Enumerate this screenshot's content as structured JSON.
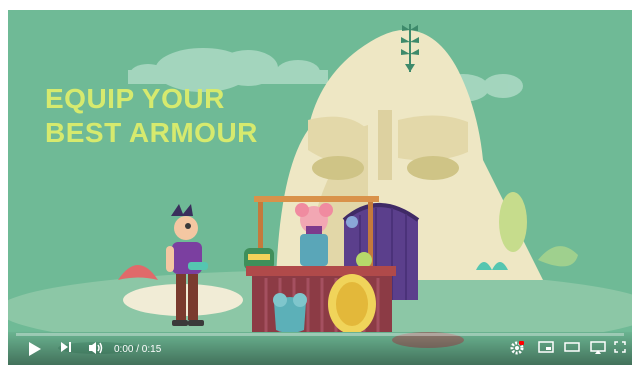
{
  "video": {
    "headline_line1": "EQUIP YOUR",
    "headline_line2": "BEST ARMOUR",
    "headline_color": "#d6ea6e",
    "background_color": "#6fba96"
  },
  "player": {
    "current_time": "0:00",
    "duration": "0:15",
    "time_display": "0:00 / 0:15",
    "progress_fraction": 0.0,
    "progress_color": "#ff0000",
    "icons": {
      "play": "play-icon",
      "next": "next-icon",
      "volume": "volume-icon",
      "settings": "settings-gear-icon",
      "miniplayer": "miniplayer-icon",
      "theater": "theater-mode-icon",
      "cast": "cast-icon",
      "fullscreen": "fullscreen-icon"
    }
  }
}
